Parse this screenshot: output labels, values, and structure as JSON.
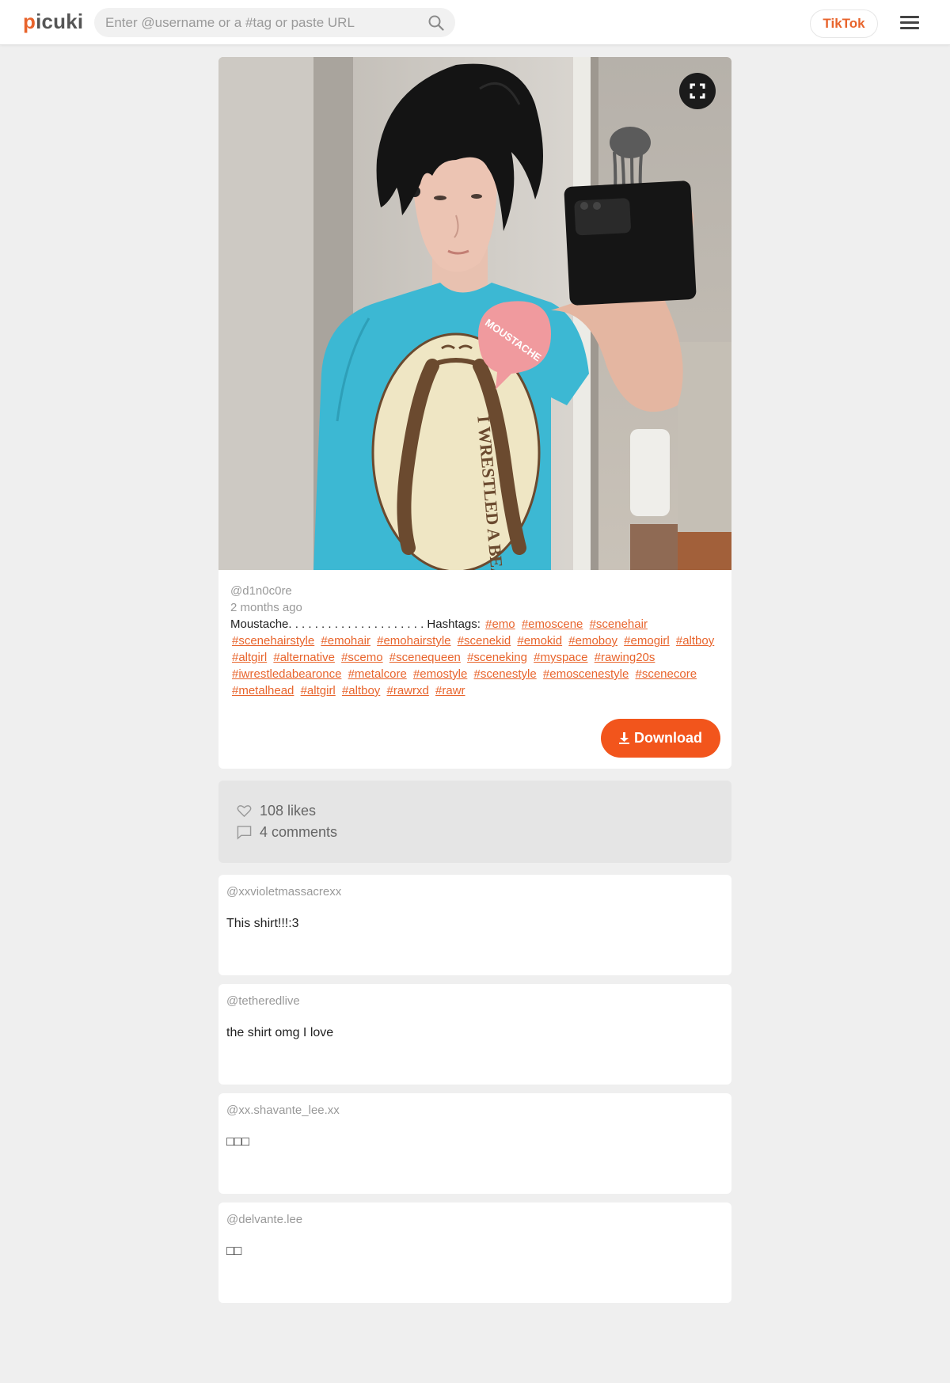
{
  "header": {
    "logo_first": "p",
    "logo_rest": "icuki",
    "search_placeholder": "Enter @username or a #tag or paste URL",
    "tiktok_label": "TikTok"
  },
  "post": {
    "username": "@d1n0c0re",
    "time_ago": "2 months ago",
    "caption_text": "Moustache. . . . . . . . . . . . . . . . . . . . . Hashtags:",
    "hashtags": [
      "#emo",
      "#emoscene",
      "#scenehair",
      "#scenehairstyle",
      "#emohair",
      "#emohairstyle",
      "#scenekid",
      "#emokid",
      "#emoboy",
      "#emogirl",
      "#altboy",
      "#altgirl",
      "#alternative",
      "#scemo",
      "#scenequeen",
      "#sceneking",
      "#myspace",
      "#rawing20s",
      "#iwrestledabearonce",
      "#metalcore",
      "#emostyle",
      "#scenestyle",
      "#emoscenestyle",
      "#scenecore",
      "#metalhead",
      "#altgirl",
      "#altboy",
      "#rawrxd",
      "#rawr"
    ],
    "shirt_text_bubble": "MOUSTACHE",
    "shirt_text_main": "I WRESTLED A BEAR ONCE",
    "download_label": "Download"
  },
  "stats": {
    "likes": "108 likes",
    "comments": "4 comments"
  },
  "comments": [
    {
      "user": "@xxvioletmassacrexx",
      "text": "This shirt!!!:3"
    },
    {
      "user": "@tetheredlive",
      "text": "the shirt omg I love"
    },
    {
      "user": "@xx.shavante_lee.xx",
      "text": "□□□"
    },
    {
      "user": "@delvante.lee",
      "text": "□□"
    }
  ],
  "colors": {
    "accent": "#e8642c",
    "download": "#f2551c",
    "background": "#efefef"
  },
  "icons": {
    "search": "search-icon",
    "menu": "hamburger-menu-icon",
    "fullscreen": "fullscreen-icon",
    "download": "download-arrow-icon",
    "likes": "heart-icon",
    "comments": "comment-bubble-icon"
  }
}
